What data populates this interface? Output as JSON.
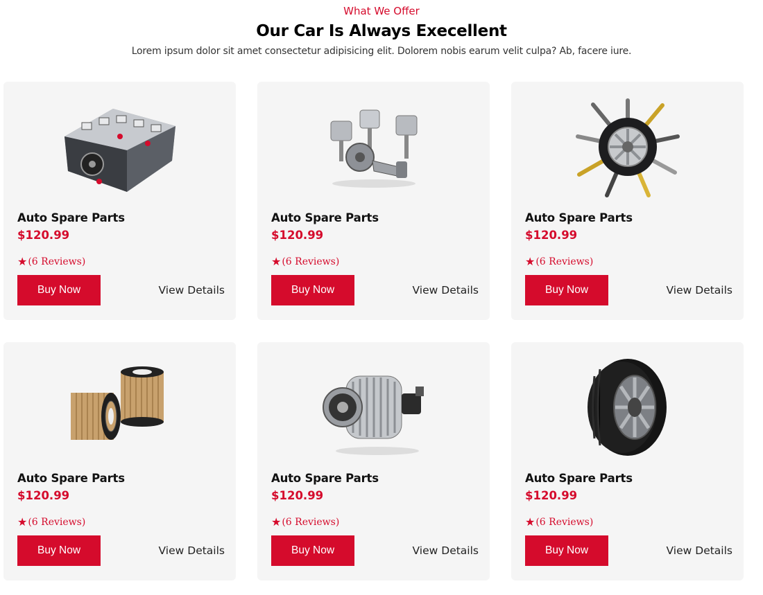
{
  "header": {
    "eyebrow": "What We Offer",
    "title": "Our Car Is Always Execellent",
    "subtitle": "Lorem ipsum dolor sit amet consectetur adipisicing elit. Dolorem nobis earum velit culpa? Ab, facere iure."
  },
  "colors": {
    "accent": "#d50b2c",
    "card_bg": "#f5f5f5"
  },
  "products": [
    {
      "image": "engine-block-image",
      "title": "Auto Spare Parts",
      "price": "$120.99",
      "reviews": "(6  Reviews)",
      "rating_icon": "star-icon",
      "buy_label": "Buy Now",
      "details_label": "View Details"
    },
    {
      "image": "pistons-crankshaft-image",
      "title": "Auto Spare Parts",
      "price": "$120.99",
      "reviews": "(6  Reviews)",
      "rating_icon": "star-icon",
      "buy_label": "Buy Now",
      "details_label": "View Details"
    },
    {
      "image": "wheel-parts-collage-image",
      "title": "Auto Spare Parts",
      "price": "$120.99",
      "reviews": "(6  Reviews)",
      "rating_icon": "star-icon",
      "buy_label": "Buy Now",
      "details_label": "View Details"
    },
    {
      "image": "oil-filters-image",
      "title": "Auto Spare Parts",
      "price": "$120.99",
      "reviews": "(6  Reviews)",
      "rating_icon": "star-icon",
      "buy_label": "Buy Now",
      "details_label": "View Details"
    },
    {
      "image": "alternator-image",
      "title": "Auto Spare Parts",
      "price": "$120.99",
      "reviews": "(6  Reviews)",
      "rating_icon": "star-icon",
      "buy_label": "Buy Now",
      "details_label": "View Details"
    },
    {
      "image": "tire-wheel-image",
      "title": "Auto Spare Parts",
      "price": "$120.99",
      "reviews": "(6  Reviews)",
      "rating_icon": "star-icon",
      "buy_label": "Buy Now",
      "details_label": "View Details"
    }
  ]
}
